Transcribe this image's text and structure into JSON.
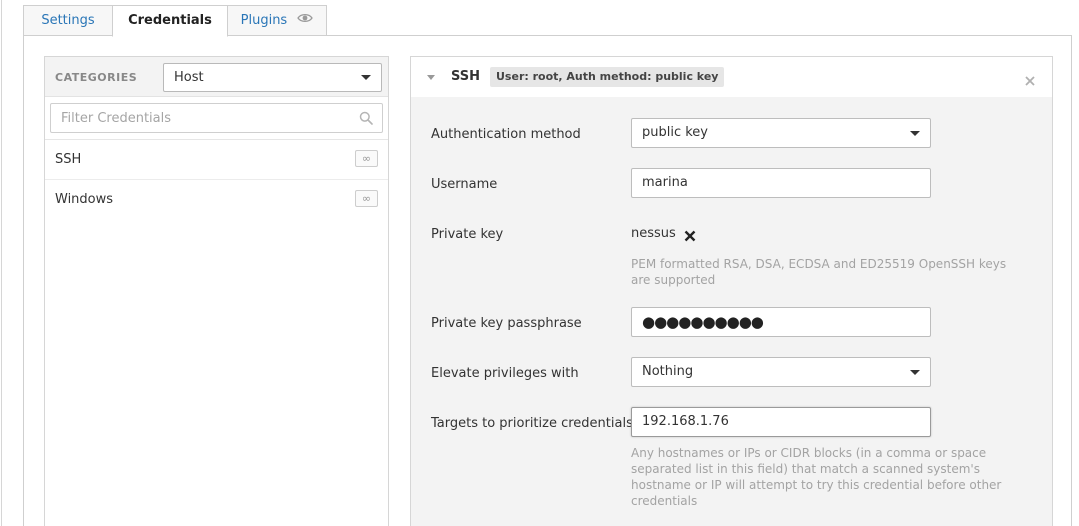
{
  "tabs": [
    {
      "label": "Settings"
    },
    {
      "label": "Credentials"
    },
    {
      "label": "Plugins"
    }
  ],
  "tab_icons": {
    "plugins": "eye-icon"
  },
  "sidebar": {
    "categories_label": "CATEGORIES",
    "category_selected": "Host",
    "filter_placeholder": "Filter Credentials",
    "items": [
      {
        "label": "SSH",
        "badge": "∞"
      },
      {
        "label": "Windows",
        "badge": "∞"
      }
    ]
  },
  "credential": {
    "title": "SSH",
    "summary": "User: root, Auth method: public key",
    "fields": {
      "auth_method_label": "Authentication method",
      "auth_method_value": "public key",
      "username_label": "Username",
      "username_value": "marina",
      "private_key_label": "Private key",
      "private_key_value": "nessus",
      "private_key_help": "PEM formatted RSA, DSA, ECDSA and ED25519 OpenSSH keys are supported",
      "passphrase_label": "Private key passphrase",
      "passphrase_value": "●●●●●●●●●●",
      "elevate_label": "Elevate privileges with",
      "elevate_value": "Nothing",
      "targets_label": "Targets to prioritize credentials",
      "targets_value": "192.168.1.76",
      "targets_help": "Any hostnames or IPs or CIDR blocks (in a comma or space separated list in this field) that match a scanned system's hostname or IP will attempt to try this credential before other credentials"
    }
  },
  "colors": {
    "link": "#2a76b7",
    "panel_bg": "#f3f3f3",
    "help_text": "#a3a3a3"
  }
}
